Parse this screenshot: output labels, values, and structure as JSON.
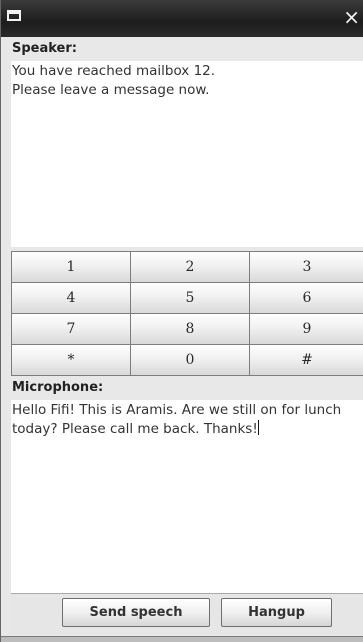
{
  "window": {
    "system_menu_icon": "window-menu-icon",
    "close_icon": "close-icon",
    "close_glyph": "×"
  },
  "speaker": {
    "label": "Speaker:",
    "text": "You have reached mailbox 12.\nPlease leave a message now."
  },
  "keypad": {
    "keys": [
      "1",
      "2",
      "3",
      "4",
      "5",
      "6",
      "7",
      "8",
      "9",
      "*",
      "0",
      "#"
    ]
  },
  "microphone": {
    "label": "Microphone:",
    "text": "Hello Fifi! This is Aramis. Are we still on for lunch today? Please call me back. Thanks!"
  },
  "buttons": {
    "send_label": "Send speech",
    "hangup_label": "Hangup"
  }
}
